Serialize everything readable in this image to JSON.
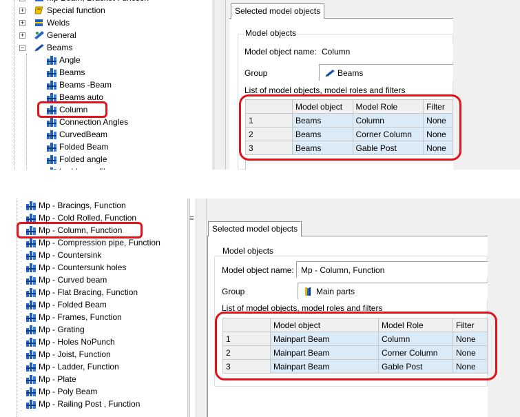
{
  "top": {
    "tree_items": [
      {
        "label": "Mp Beam, Bracket Function",
        "icon": "component-icon",
        "indent": 1,
        "expander": "plus"
      },
      {
        "label": "Special function",
        "icon": "special-function-icon",
        "indent": 1,
        "expander": "plus"
      },
      {
        "label": "Welds",
        "icon": "welds-icon",
        "indent": 1,
        "expander": "plus"
      },
      {
        "label": "General",
        "icon": "general-icon",
        "indent": 1,
        "expander": "plus"
      },
      {
        "label": "Beams",
        "icon": "beams-group-icon",
        "indent": 1,
        "expander": "minus"
      },
      {
        "label": "Angle",
        "icon": "model-object-icon",
        "indent": 2
      },
      {
        "label": "Beams",
        "icon": "model-object-icon",
        "indent": 2
      },
      {
        "label": "Beams -Beam",
        "icon": "model-object-icon",
        "indent": 2
      },
      {
        "label": "Beams auto",
        "icon": "model-object-icon",
        "indent": 2
      },
      {
        "label": "Column",
        "icon": "model-object-icon",
        "indent": 2,
        "highlight": true
      },
      {
        "label": "Connection Angles",
        "icon": "model-object-icon",
        "indent": 2
      },
      {
        "label": "CurvedBeam",
        "icon": "model-object-icon",
        "indent": 2
      },
      {
        "label": "Folded Beam",
        "icon": "model-object-icon",
        "indent": 2
      },
      {
        "label": "Folded angle",
        "icon": "model-object-icon",
        "indent": 2
      },
      {
        "label": "Ladder profile",
        "icon": "model-object-icon",
        "indent": 2
      }
    ],
    "tab_label": "Selected model objects",
    "group_title": "Model objects",
    "name_label": "Model object name:",
    "name_value": "Column",
    "group_label": "Group",
    "group_value": "Beams",
    "list_label": "List of model objects, model roles and filters",
    "columns": [
      "Model object",
      "Model Role",
      "Filter"
    ],
    "rows": [
      {
        "num": "1",
        "object": "Beams",
        "role": "Column",
        "filter": "None"
      },
      {
        "num": "2",
        "object": "Beams",
        "role": "Corner Column",
        "filter": "None"
      },
      {
        "num": "3",
        "object": "Beams",
        "role": "Gable Post",
        "filter": "None"
      }
    ]
  },
  "bottom": {
    "tree_items": [
      {
        "label": "Mp - Bracings, Function",
        "highlight": false
      },
      {
        "label": "Mp - Cold Rolled, Function",
        "highlight": false
      },
      {
        "label": "Mp - Column, Function",
        "highlight": true
      },
      {
        "label": "Mp - Compression pipe, Function",
        "highlight": false
      },
      {
        "label": "Mp - Countersink",
        "highlight": false
      },
      {
        "label": "Mp - Countersunk holes",
        "highlight": false
      },
      {
        "label": "Mp - Curved beam",
        "highlight": false
      },
      {
        "label": "Mp - Flat Bracing, Function",
        "highlight": false
      },
      {
        "label": "Mp - Folded Beam",
        "highlight": false
      },
      {
        "label": "Mp - Frames, Function",
        "highlight": false
      },
      {
        "label": "Mp - Grating",
        "highlight": false
      },
      {
        "label": "Mp - Holes NoPunch",
        "highlight": false
      },
      {
        "label": "Mp - Joist, Function",
        "highlight": false
      },
      {
        "label": "Mp - Ladder, Function",
        "highlight": false
      },
      {
        "label": "Mp - Plate",
        "highlight": false
      },
      {
        "label": "Mp - Poly Beam",
        "highlight": false
      },
      {
        "label": "Mp - Railing Post , Function",
        "highlight": false
      }
    ],
    "tab_label": "Selected model objects",
    "group_title": "Model objects",
    "name_label": "Model object name:",
    "name_value": "Mp - Column, Function",
    "group_label": "Group",
    "group_value": "Main parts",
    "list_label": "List of model objects, model roles and filters",
    "columns": [
      "Model object",
      "Model Role",
      "Filter"
    ],
    "rows": [
      {
        "num": "1",
        "object": "Mainpart Beam",
        "role": "Column",
        "filter": "None"
      },
      {
        "num": "2",
        "object": "Mainpart Beam",
        "role": "Corner Column",
        "filter": "None"
      },
      {
        "num": "3",
        "object": "Mainpart Beam",
        "role": "Gable Post",
        "filter": "None"
      }
    ],
    "splitter_glyph": "≡"
  },
  "colors": {
    "highlight_ring": "#e0121a",
    "selected_cell": "#dbeaf7",
    "panel_bg": "#f0f0f0",
    "icon_blue": "#1f5fbf"
  }
}
